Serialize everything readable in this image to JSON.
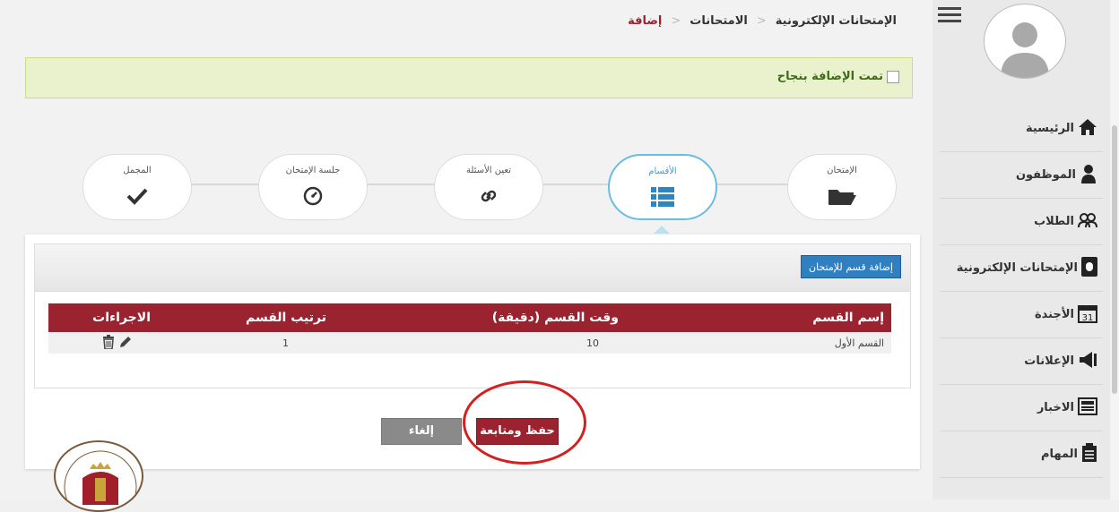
{
  "breadcrumb": {
    "items": [
      "الإمتحانات الإلكترونية",
      "الامتحانات",
      "إضافة"
    ]
  },
  "alert": {
    "message": "تمت الإضافة بنجاح"
  },
  "steps": [
    {
      "label": "الإمتحان",
      "icon": "folder-open-icon",
      "active": false
    },
    {
      "label": "الأقسام",
      "icon": "list-icon",
      "active": true
    },
    {
      "label": "تعين الأسئلة",
      "icon": "link-icon",
      "active": false
    },
    {
      "label": "جلسة الإمتحان",
      "icon": "dashboard-icon",
      "active": false
    },
    {
      "label": "المجمل",
      "icon": "check-icon",
      "active": false
    }
  ],
  "panel": {
    "add_button": "إضافة قسم للإمتحان"
  },
  "table": {
    "headers": [
      "إسم القسم",
      "وقت القسم (دقيقة)",
      "ترتيب القسم",
      "الاجراءات"
    ],
    "rows": [
      {
        "name": "القسم الأول",
        "time": "10",
        "order": "1"
      }
    ]
  },
  "buttons": {
    "save": "حفظ ومتابعة",
    "cancel": "إلغاء"
  },
  "sidebar": {
    "items": [
      {
        "label": "الرئيسية",
        "icon": "home-icon"
      },
      {
        "label": "الموظفون",
        "icon": "user-icon"
      },
      {
        "label": "الطلاب",
        "icon": "students-icon"
      },
      {
        "label": "الإمتحانات الإلكترونية",
        "icon": "exam-icon"
      },
      {
        "label": "الأجندة",
        "icon": "calendar-icon"
      },
      {
        "label": "الإعلانات",
        "icon": "megaphone-icon"
      },
      {
        "label": "الاخبار",
        "icon": "news-icon"
      },
      {
        "label": "المهام",
        "icon": "tasks-icon"
      }
    ]
  },
  "colors": {
    "primary": "#9b2330",
    "accent_blue": "#2f7fc1",
    "success_bg": "#e9f2cc",
    "highlight_circle": "#d42020"
  }
}
